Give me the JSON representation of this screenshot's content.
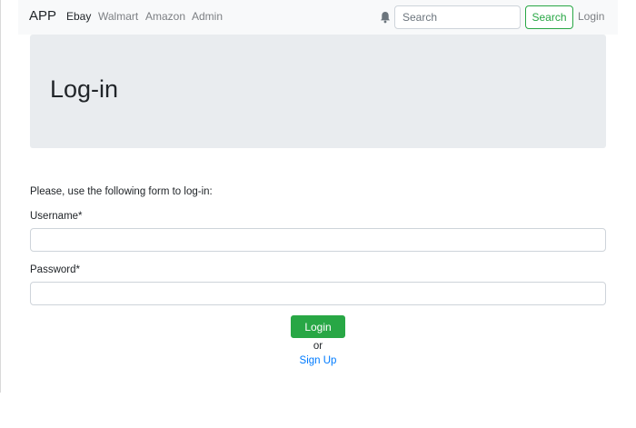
{
  "navbar": {
    "brand": "APP",
    "links": [
      "Ebay",
      "Walmart",
      "Amazon",
      "Admin"
    ],
    "active_link": "Ebay",
    "search": {
      "placeholder": "Search",
      "value": ""
    },
    "search_button": "Search",
    "login_link": "Login",
    "notification_icon": "bell-icon"
  },
  "jumbotron": {
    "title": "Log-in"
  },
  "form": {
    "intro": "Please, use the following form to log-in:",
    "username_label": "Username*",
    "username_value": "",
    "password_label": "Password*",
    "password_value": "",
    "submit_label": "Login",
    "or_text": "or",
    "signup_link": "Sign Up"
  },
  "colors": {
    "navbar_bg": "#f8f9fa",
    "jumbotron_bg": "#e9ecef",
    "success": "#28a745",
    "link": "#007bff"
  }
}
